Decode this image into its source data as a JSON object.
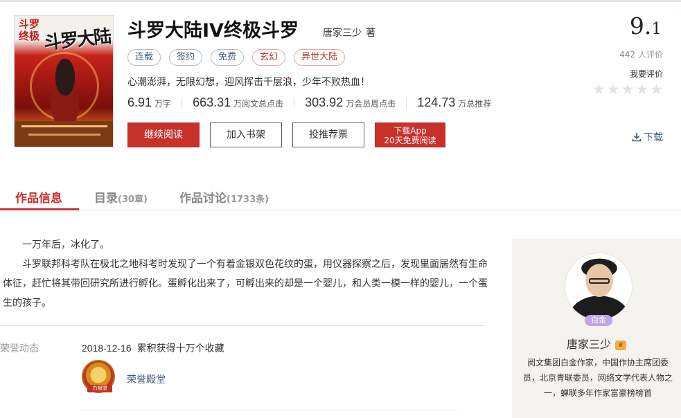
{
  "book": {
    "cover": {
      "top_text": "斗罗 终极",
      "logo_text": "斗罗大陆"
    },
    "title": "斗罗大陆IV终极斗罗",
    "author": "唐家三少",
    "author_suffix": "著",
    "tags": [
      {
        "label": "连载",
        "style": "blue"
      },
      {
        "label": "签约",
        "style": "blue"
      },
      {
        "label": "免费",
        "style": "blue"
      },
      {
        "label": "玄幻",
        "style": "red"
      },
      {
        "label": "异世大陆",
        "style": "red"
      }
    ],
    "intro": "心潮澎湃，无限幻想，迎风挥击千层浪，少年不败热血！",
    "stats": [
      {
        "value": "6.91",
        "unit": "万字"
      },
      {
        "value": "663.31",
        "unit": "万阅文总点击"
      },
      {
        "value": "303.92",
        "unit": "万会员周点击"
      },
      {
        "value": "124.73",
        "unit": "万总推荐"
      }
    ]
  },
  "actions": {
    "read": "继续阅读",
    "shelf": "加入书架",
    "vote": "投推荐票",
    "app_line1": "下载App",
    "app_line2": "20天免费阅读"
  },
  "rating": {
    "score_int": "9.",
    "score_dec": "1",
    "count": "442",
    "count_label": "人评价",
    "my_rating_label": "我要评价",
    "stars": 5,
    "download_label": "下载"
  },
  "tabs": [
    {
      "label": "作品信息",
      "count": "",
      "active": true
    },
    {
      "label": "目录",
      "count": "(30章)",
      "active": false
    },
    {
      "label": "作品讨论",
      "count": "(1733条)",
      "active": false
    }
  ],
  "description": {
    "line1": "一万年后，冰化了。",
    "line2": "斗罗联邦科考队在极北之地科考时发现了一个有着金银双色花纹的蛋，用仪器探察之后，发现里面居然有生命体征，赶忙将其带回研究所进行孵化。蛋孵化出来了，可孵出来的却是一个婴儿，和人类一模一样的婴儿，一个蛋生的孩子。"
  },
  "honors": {
    "label": "荣誉动态",
    "date": "2018-12-16",
    "text": "累积获得十万个收藏",
    "medal_text": "白银盟",
    "link": "荣誉殿堂"
  },
  "author_card": {
    "level_badge": "白金",
    "name": "唐家三少",
    "bio": "阅文集团白金作家，中国作协主席团委员，北京青联委员，网络文学代表人物之一，蝉联多年作家富豪榜榜首"
  },
  "colors": {
    "accent": "#c8302a",
    "link": "#3e5877"
  }
}
